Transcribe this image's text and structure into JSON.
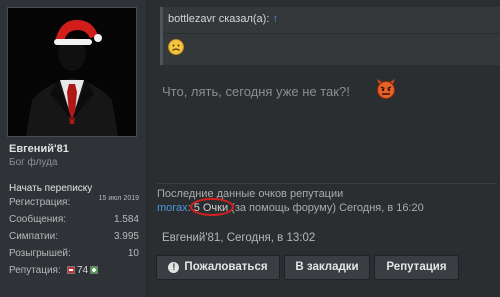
{
  "user": {
    "name": "Евгений'81",
    "title": "Бог флуда",
    "start_conversation": "Начать переписку",
    "stats": [
      {
        "label": "Регистрация:",
        "value": "15 июл 2019"
      },
      {
        "label": "Сообщения:",
        "value": "1.584"
      },
      {
        "label": "Симпатии:",
        "value": "3.995"
      },
      {
        "label": "Розыгрышей:",
        "value": "10"
      }
    ],
    "reputation_label": "Репутация:",
    "reputation_value": "74"
  },
  "quote": {
    "author_line": "bottlezavr сказал(а):",
    "arrow": "↑",
    "emoji": "sad-emoji"
  },
  "message": {
    "text": "Что, лять, сегодня уже не так?!",
    "emoji": "angry-devil-emoji"
  },
  "reputation": {
    "title": "Последние данные очков репутации",
    "user": "morax",
    "separator": ":",
    "points": "5 Очки",
    "reason": "(за помощь форуму) Сегодня, в 16:20"
  },
  "post": {
    "info": "Евгений'81, Сегодня, в 13:02"
  },
  "actions": {
    "report": "Пожаловаться",
    "bookmark": "В закладки",
    "reputation": "Репутация"
  },
  "colors": {
    "link": "#4d97d9",
    "highlight_circle": "#d62020",
    "background": "#2b2e31"
  }
}
